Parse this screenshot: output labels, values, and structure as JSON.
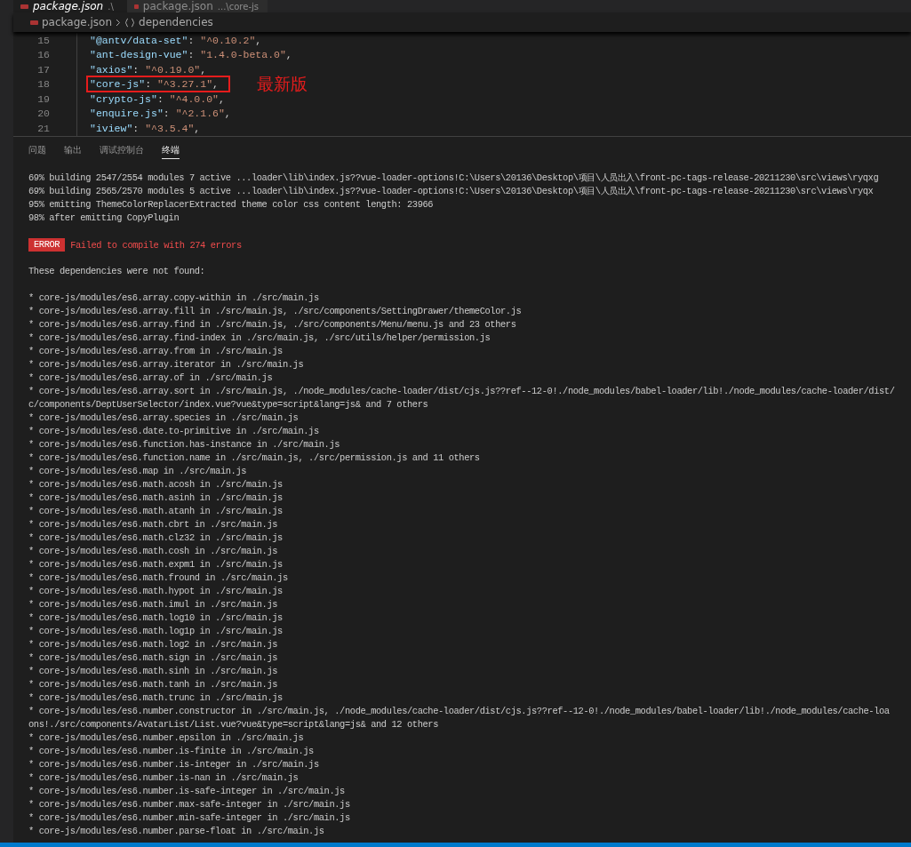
{
  "editor_tabs": [
    {
      "label": "package.json",
      "description": ".\\",
      "selected": true
    },
    {
      "label": "package.json",
      "description": "...\\core-js",
      "selected": false
    }
  ],
  "breadcrumb": [
    "package.json",
    "dependencies"
  ],
  "code_lines": [
    {
      "number": "15",
      "text": "\"@antv/data-set\": \"^0.10.2\",",
      "highlighted": false
    },
    {
      "number": "16",
      "text": "\"ant-design-vue\": \"1.4.0-beta.0\",",
      "highlighted": false
    },
    {
      "number": "17",
      "text": "\"axios\": \"^0.19.0\",",
      "highlighted": false
    },
    {
      "number": "18",
      "text": "\"core-js\": \"^3.27.1\",",
      "highlighted": true
    },
    {
      "number": "19",
      "text": "\"crypto-js\": \"^4.0.0\",",
      "highlighted": false
    },
    {
      "number": "20",
      "text": "\"enquire.js\": \"^2.1.6\",",
      "highlighted": false
    },
    {
      "number": "21",
      "text": "\"iview\": \"^3.5.4\",",
      "highlighted": false
    }
  ],
  "annotation": "最新版",
  "panel_tabs": [
    {
      "label": "问题",
      "selected": false
    },
    {
      "label": "输出",
      "selected": false
    },
    {
      "label": "调试控制台",
      "selected": false
    },
    {
      "label": "终端",
      "selected": true
    }
  ],
  "terminal": {
    "progress_lines": [
      "69% building 2547/2554 modules 7 active ...loader\\lib\\index.js??vue-loader-options!C:\\Users\\20136\\Desktop\\项目\\人员出入\\front-pc-tags-release-20211230\\src\\views\\ryqxg",
      "69% building 2565/2570 modules 5 active ...loader\\lib\\index.js??vue-loader-options!C:\\Users\\20136\\Desktop\\项目\\人员出入\\front-pc-tags-release-20211230\\src\\views\\ryqx",
      "95% emitting ThemeColorReplacerExtracted theme color css content length: 23966",
      "98% after emitting CopyPlugin"
    ],
    "error": {
      "badge": "ERROR",
      "message": "Failed to compile with 274 errors"
    },
    "heading": "These dependencies were not found:",
    "missing": [
      "* core-js/modules/es6.array.copy-within in ./src/main.js",
      "* core-js/modules/es6.array.fill in ./src/main.js, ./src/components/SettingDrawer/themeColor.js",
      "* core-js/modules/es6.array.find in ./src/main.js, ./src/components/Menu/menu.js and 23 others",
      "* core-js/modules/es6.array.find-index in ./src/main.js, ./src/utils/helper/permission.js",
      "* core-js/modules/es6.array.from in ./src/main.js",
      "* core-js/modules/es6.array.iterator in ./src/main.js",
      "* core-js/modules/es6.array.of in ./src/main.js",
      "* core-js/modules/es6.array.sort in ./src/main.js, ./node_modules/cache-loader/dist/cjs.js??ref--12-0!./node_modules/babel-loader/lib!./node_modules/cache-loader/dist/",
      "c/components/DeptUserSelector/index.vue?vue&type=script&lang=js& and 7 others",
      "* core-js/modules/es6.array.species in ./src/main.js",
      "* core-js/modules/es6.date.to-primitive in ./src/main.js",
      "* core-js/modules/es6.function.has-instance in ./src/main.js",
      "* core-js/modules/es6.function.name in ./src/main.js, ./src/permission.js and 11 others",
      "* core-js/modules/es6.map in ./src/main.js",
      "* core-js/modules/es6.math.acosh in ./src/main.js",
      "* core-js/modules/es6.math.asinh in ./src/main.js",
      "* core-js/modules/es6.math.atanh in ./src/main.js",
      "* core-js/modules/es6.math.cbrt in ./src/main.js",
      "* core-js/modules/es6.math.clz32 in ./src/main.js",
      "* core-js/modules/es6.math.cosh in ./src/main.js",
      "* core-js/modules/es6.math.expm1 in ./src/main.js",
      "* core-js/modules/es6.math.fround in ./src/main.js",
      "* core-js/modules/es6.math.hypot in ./src/main.js",
      "* core-js/modules/es6.math.imul in ./src/main.js",
      "* core-js/modules/es6.math.log10 in ./src/main.js",
      "* core-js/modules/es6.math.log1p in ./src/main.js",
      "* core-js/modules/es6.math.log2 in ./src/main.js",
      "* core-js/modules/es6.math.sign in ./src/main.js",
      "* core-js/modules/es6.math.sinh in ./src/main.js",
      "* core-js/modules/es6.math.tanh in ./src/main.js",
      "* core-js/modules/es6.math.trunc in ./src/main.js",
      "* core-js/modules/es6.number.constructor in ./src/main.js, ./node_modules/cache-loader/dist/cjs.js??ref--12-0!./node_modules/babel-loader/lib!./node_modules/cache-loa",
      "ons!./src/components/AvatarList/List.vue?vue&type=script&lang=js& and 12 others",
      "* core-js/modules/es6.number.epsilon in ./src/main.js",
      "* core-js/modules/es6.number.is-finite in ./src/main.js",
      "* core-js/modules/es6.number.is-integer in ./src/main.js",
      "* core-js/modules/es6.number.is-nan in ./src/main.js",
      "* core-js/modules/es6.number.is-safe-integer in ./src/main.js",
      "* core-js/modules/es6.number.max-safe-integer in ./src/main.js",
      "* core-js/modules/es6.number.min-safe-integer in ./src/main.js",
      "* core-js/modules/es6.number.parse-float in ./src/main.js"
    ]
  }
}
